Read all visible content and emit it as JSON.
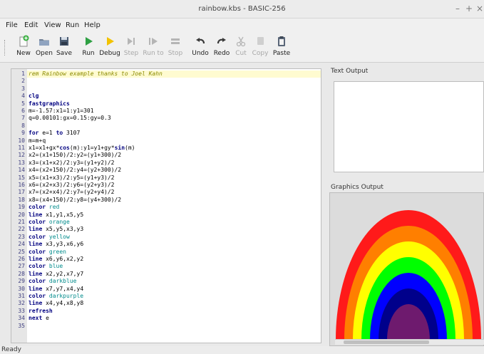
{
  "window": {
    "title": "rainbow.kbs - BASIC-256",
    "controls": [
      "–",
      "+",
      "×"
    ]
  },
  "menu": [
    "File",
    "Edit",
    "View",
    "Run",
    "Help"
  ],
  "toolbar": [
    {
      "label": "New",
      "icon": "new-file-icon",
      "enabled": true
    },
    {
      "label": "Open",
      "icon": "open-folder-icon",
      "enabled": true
    },
    {
      "label": "Save",
      "icon": "save-icon",
      "enabled": true
    },
    {
      "label": "Run",
      "icon": "run-icon",
      "enabled": true
    },
    {
      "label": "Debug",
      "icon": "debug-icon",
      "enabled": true
    },
    {
      "label": "Step",
      "icon": "step-icon",
      "enabled": false
    },
    {
      "label": "Run to",
      "icon": "run-to-icon",
      "enabled": false
    },
    {
      "label": "Stop",
      "icon": "stop-icon",
      "enabled": false
    },
    {
      "label": "Undo",
      "icon": "undo-icon",
      "enabled": true
    },
    {
      "label": "Redo",
      "icon": "redo-icon",
      "enabled": true
    },
    {
      "label": "Cut",
      "icon": "cut-icon",
      "enabled": false
    },
    {
      "label": "Copy",
      "icon": "copy-icon",
      "enabled": false
    },
    {
      "label": "Paste",
      "icon": "paste-icon",
      "enabled": true
    }
  ],
  "code": [
    "rem Rainbow example thanks to Joel Kahn",
    "",
    "",
    "clg",
    "fastgraphics",
    "m=-1.57:x1=1:y1=301",
    "q=0.00101:gx=0.15:gy=0.3",
    "",
    "for e=1 to 3107",
    "m=m+q",
    "x1=x1+gx*cos(m):y1=y1+gy*sin(m)",
    "x2=(x1+150)/2:y2=(y1+300)/2",
    "x3=(x1+x2)/2:y3=(y1+y2)/2",
    "x4=(x2+150)/2:y4=(y2+300)/2",
    "x5=(x1+x3)/2:y5=(y1+y3)/2",
    "x6=(x2+x3)/2:y6=(y2+y3)/2",
    "x7=(x2+x4)/2:y7=(y2+y4)/2",
    "x8=(x4+150)/2:y8=(y4+300)/2",
    "color red",
    "line x1,y1,x5,y5",
    "color orange",
    "line x5,y5,x3,y3",
    "color yellow",
    "line x3,y3,x6,y6",
    "color green",
    "line x6,y6,x2,y2",
    "color blue",
    "line x2,y2,x7,y7",
    "color darkblue",
    "line x7,y7,x4,y4",
    "color darkpurple",
    "line x4,y4,x8,y8",
    "refresh",
    "next e",
    ""
  ],
  "keywords": [
    "clg",
    "fastgraphics",
    "for",
    "to",
    "color",
    "line",
    "refresh",
    "next",
    "cos",
    "sin"
  ],
  "panes": {
    "text_output": "Text Output",
    "graphics_output": "Graphics Output"
  },
  "rainbow_colors": [
    "#ff1a1a",
    "#ff7f00",
    "#ffff00",
    "#00ff00",
    "#0000ff",
    "#00008b",
    "#6e1a6e"
  ],
  "colors": {
    "code_highlight": "#fffbd0",
    "keyword": "#000080",
    "comment": "#8a8a00",
    "color_name": "#008b8b",
    "accent_green": "#2ea043",
    "gutter": "#e6e6e6"
  },
  "status": "Ready"
}
